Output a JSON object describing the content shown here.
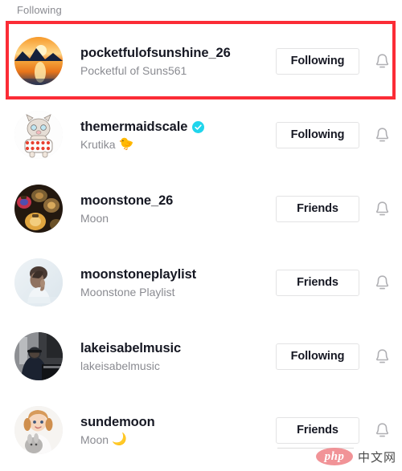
{
  "header": {
    "title": "Following"
  },
  "highlight": {
    "color": "#fb2c36",
    "target_row_index": 0
  },
  "colors": {
    "text_primary": "#161823",
    "text_secondary": "#8a8b91",
    "button_border": "#e3e3e4",
    "verified_badge": "#20d5ec",
    "highlight_red": "#fb2c36",
    "watermark_pink": "#f08a8f"
  },
  "rows": [
    {
      "username": "pocketfulofsunshine_26",
      "nickname": "Pocketful of Suns561",
      "nickname_emoji": "",
      "verified": false,
      "button_label": "Following",
      "bell_icon": "bell-icon",
      "avatar": "sunset-lake-photo"
    },
    {
      "username": "themermaidscale",
      "nickname": "Krutika",
      "nickname_emoji": "🐤",
      "verified": true,
      "button_label": "Following",
      "bell_icon": "bell-icon",
      "avatar": "cartoon-creature-strawberry-shorts"
    },
    {
      "username": "moonstone_26",
      "nickname": "Moon",
      "nickname_emoji": "",
      "verified": false,
      "button_label": "Friends",
      "bell_icon": "bell-icon",
      "avatar": "dark-colorful-lanterns-photo"
    },
    {
      "username": "moonstoneplaylist",
      "nickname": "Moonstone Playlist",
      "nickname_emoji": "",
      "verified": false,
      "button_label": "Friends",
      "bell_icon": "bell-icon",
      "avatar": "pale-portrait-praying-photo"
    },
    {
      "username": "lakeisabelmusic",
      "nickname": "lakeisabelmusic",
      "nickname_emoji": "",
      "verified": false,
      "button_label": "Following",
      "bell_icon": "bell-icon",
      "avatar": "dark-piano-player-photo"
    },
    {
      "username": "sundemoon",
      "nickname": "Moon",
      "nickname_emoji": "🌙",
      "verified": false,
      "button_label": "Friends",
      "bell_icon": "bell-icon",
      "avatar": "child-with-bunny-photo"
    }
  ],
  "watermark": {
    "logo_text": "php",
    "site_text": "中文网"
  }
}
